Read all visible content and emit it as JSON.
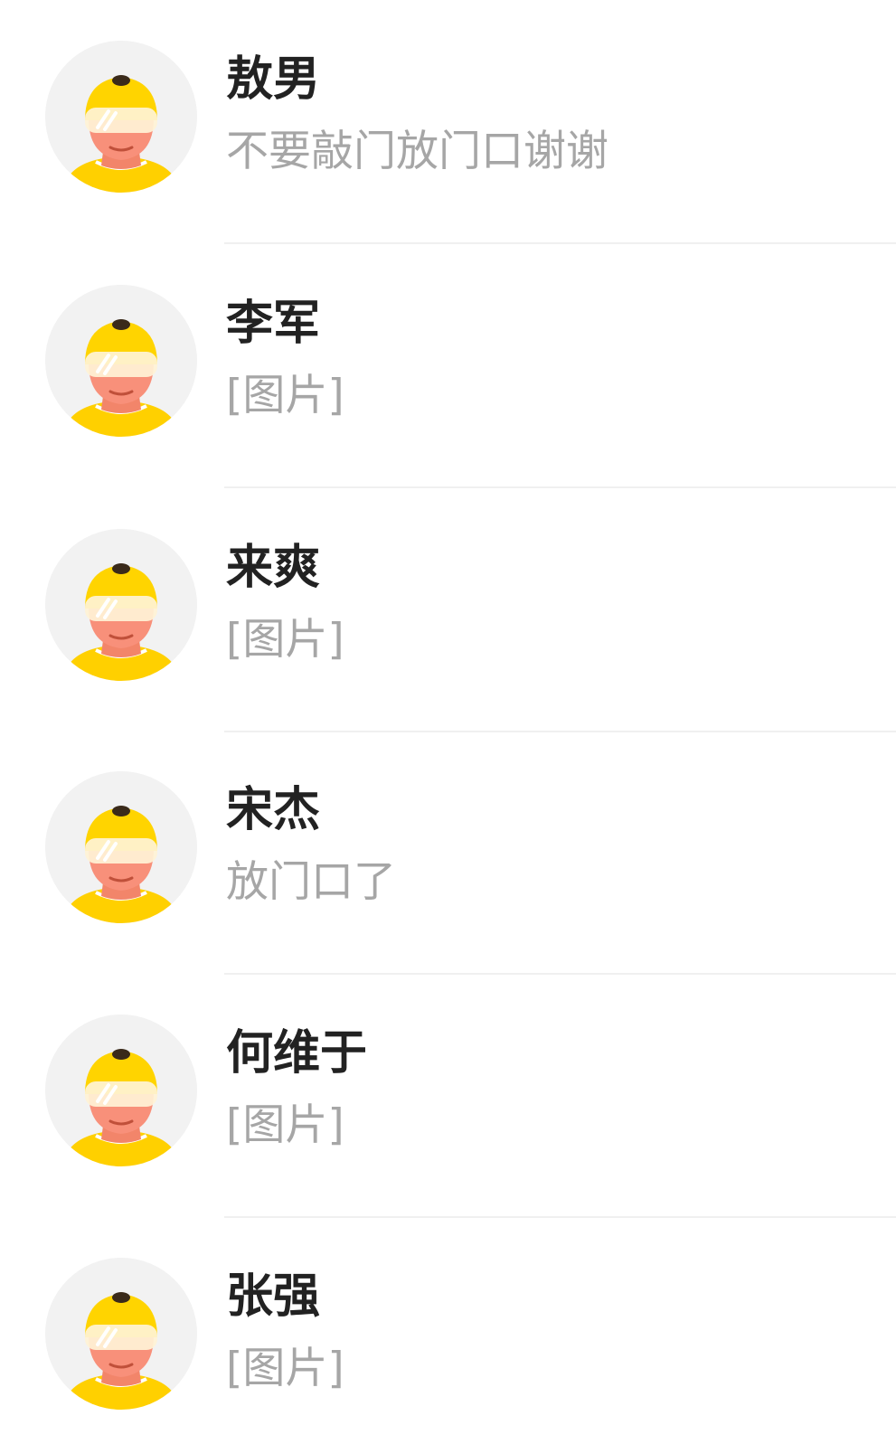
{
  "conversations": [
    {
      "name": "敖男",
      "preview": "不要敲门放门口谢谢",
      "avatar": "courier-avatar-icon"
    },
    {
      "name": "李军",
      "preview": "[图片]",
      "avatar": "courier-avatar-icon"
    },
    {
      "name": "来爽",
      "preview": "[图片]",
      "avatar": "courier-avatar-icon"
    },
    {
      "name": "宋杰",
      "preview": "放门口了",
      "avatar": "courier-avatar-icon"
    },
    {
      "name": "何维于",
      "preview": "[图片]",
      "avatar": "courier-avatar-icon"
    },
    {
      "name": "张强",
      "preview": "[图片]",
      "avatar": "courier-avatar-icon"
    }
  ],
  "colors": {
    "helmet": "#ffd400",
    "shirt": "#ffd000",
    "skin": "#f2856a",
    "avatar_bg": "#f2f2f2",
    "name_text": "#222222",
    "preview_text": "#a6a6a6",
    "divider": "#f0f0f0"
  }
}
